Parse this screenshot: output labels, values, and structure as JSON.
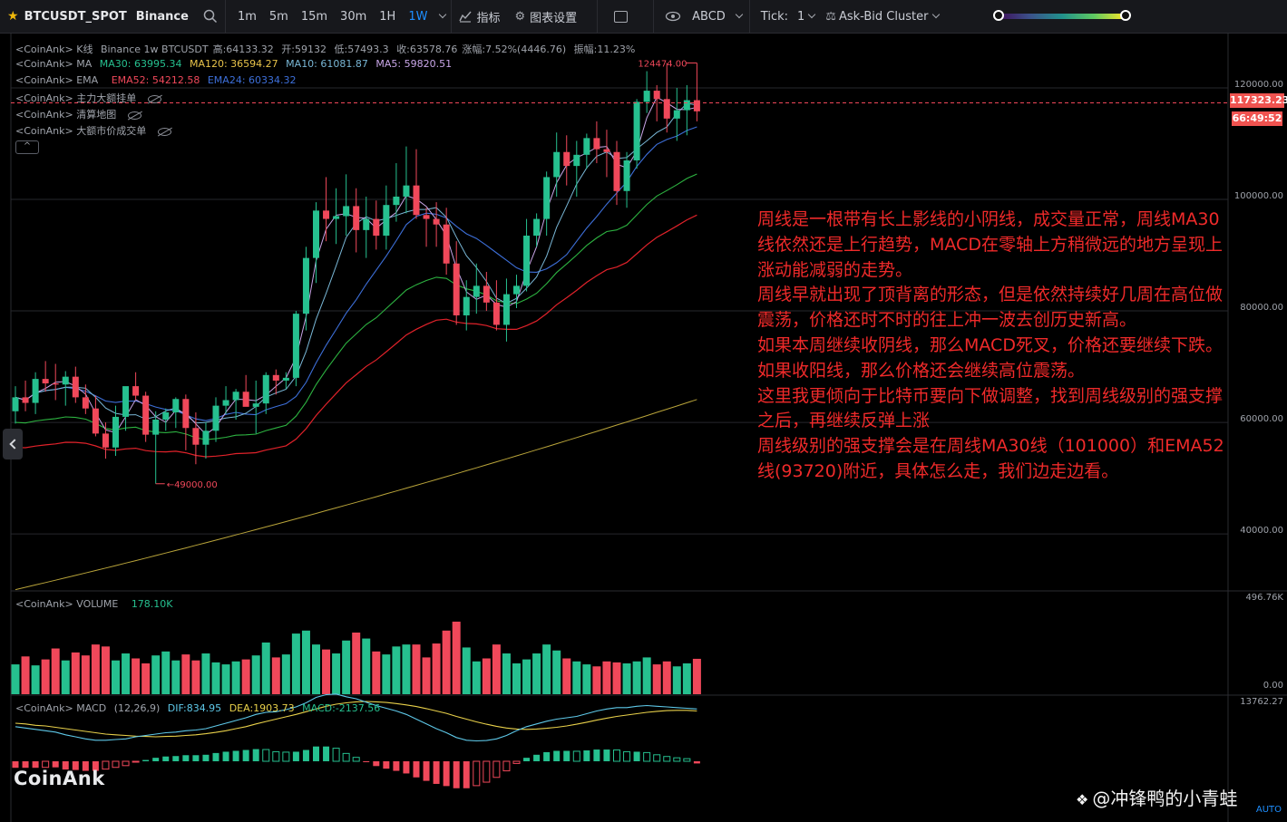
{
  "toolbar": {
    "symbol": "BTCUSDT_SPOT",
    "exchange": "Binance",
    "intervals": [
      "1m",
      "5m",
      "15m",
      "30m",
      "1H",
      "1W"
    ],
    "active_interval": "1W",
    "indicators_label": "指标",
    "chart_settings_label": "图表设置",
    "abcd_label": "ABCD",
    "tick_label": "Tick:",
    "tick_value": "1",
    "cluster_label": "Ask-Bid Cluster"
  },
  "legend": {
    "kline": {
      "prefix": "<CoinAnk> K线",
      "source": "Binance 1w BTCUSDT",
      "high": "高:64133.32",
      "open": "开:59132",
      "low": "低:57493.3",
      "close": "收:63578.76",
      "change": "涨幅:7.52%(4446.76)",
      "amplitude": "振幅:11.23%"
    },
    "ma": {
      "prefix": "<CoinAnk> MA",
      "ma30": "MA30: 63995.34",
      "ma120": "MA120: 36594.27",
      "ma10": "MA10: 61081.87",
      "ma5": "MA5: 59820.51"
    },
    "ema": {
      "prefix": "<CoinAnk> EMA",
      "ema52": "EMA52: 54212.58",
      "ema24": "EMA24: 60334.32"
    },
    "extra1": "<CoinAnk> 主力大额挂单",
    "extra2": "<CoinAnk> 清算地图",
    "extra3": "<CoinAnk> 大额市价成交单",
    "collapse": "^"
  },
  "price_axis": {
    "labels": [
      "120000.00",
      "100000.00",
      "80000.00",
      "60000.00",
      "40000.00"
    ],
    "current_price": "117323.23",
    "countdown": "66:49:52",
    "high_marker": "124474.00",
    "low_marker": "49000.00"
  },
  "volume_panel": {
    "title": "<CoinAnk> VOLUME",
    "value": "178.10K",
    "axis_top": "496.76K",
    "axis_bottom": "0.00"
  },
  "macd_panel": {
    "title": "<CoinAnk> MACD",
    "params": "(12,26,9)",
    "dif": "DIF:834.95",
    "dea": "DEA:1903.73",
    "macd": "MACD:-2137.56",
    "axis_top": "13762.27"
  },
  "annotation": [
    "周线是一根带有长上影线的小阴线，成交量正常，周线MA30线依然还是上行趋势，MACD在零轴上方稍微远的地方呈现上涨动能减弱的走势。",
    "周线早就出现了顶背离的形态，但是依然持续好几周在高位做震荡，价格还时不时的往上冲一波去创历史新高。",
    "如果本周继续收阴线，那么MACD死叉，价格还要继续下跌。如果收阳线，那么价格还会继续高位震荡。",
    "这里我更倾向于比特币要向下做调整，找到周线级别的强支撑之后，再继续反弹上涨",
    "周线级别的强支撑会是在周线MA30线（101000）和EMA52线(93720)附近，具体怎么走，我们边走边看。"
  ],
  "watermark": "CoinAnk",
  "credit": "@冲锋鸭的小青蛙",
  "auto_label": "AUTO",
  "colors": {
    "up": "#26c08f",
    "down": "#f0485a",
    "ma5": "#c9a6e8",
    "ma10": "#79b7d6",
    "ma30": "#3d6fd9",
    "ema24": "#2db341",
    "ema52": "#e0222a",
    "ma120": "#b9a43a",
    "dif": "#5ec8e8",
    "dea": "#e8d04a",
    "annotation": "#ef2a2a"
  },
  "chart_data": {
    "type": "candlestick",
    "interval": "1w",
    "symbol": "BTCUSDT",
    "ylim": [
      30000,
      130000
    ],
    "candles": [
      [
        62000,
        66500,
        59800,
        64500
      ],
      [
        64500,
        67500,
        62000,
        63500
      ],
      [
        63500,
        69000,
        61500,
        67800
      ],
      [
        67800,
        71000,
        65500,
        67000
      ],
      [
        67000,
        70500,
        64000,
        66800
      ],
      [
        66800,
        69200,
        63000,
        68200
      ],
      [
        68200,
        70000,
        63500,
        64500
      ],
      [
        64500,
        66800,
        61500,
        62500
      ],
      [
        62500,
        64800,
        57500,
        58000
      ],
      [
        58000,
        60000,
        53500,
        55500
      ],
      [
        55500,
        63000,
        54000,
        61000
      ],
      [
        61000,
        66000,
        58500,
        66500
      ],
      [
        66500,
        69000,
        64000,
        64800
      ],
      [
        64800,
        65500,
        56500,
        57800
      ],
      [
        57800,
        62000,
        49000,
        60500
      ],
      [
        60500,
        62500,
        58500,
        61800
      ],
      [
        61800,
        64500,
        59000,
        64200
      ],
      [
        64200,
        65000,
        55000,
        59000
      ],
      [
        59000,
        61800,
        52500,
        56000
      ],
      [
        56000,
        60000,
        53500,
        58500
      ],
      [
        58500,
        64500,
        56500,
        63000
      ],
      [
        63000,
        66500,
        61500,
        64000
      ],
      [
        64000,
        66000,
        60500,
        65500
      ],
      [
        65500,
        68500,
        63000,
        62800
      ],
      [
        62800,
        67500,
        58000,
        63400
      ],
      [
        63400,
        69000,
        61500,
        68500
      ],
      [
        68500,
        69500,
        65000,
        67500
      ],
      [
        67500,
        69000,
        66000,
        68000
      ],
      [
        68000,
        80000,
        66500,
        79500
      ],
      [
        79500,
        91500,
        76500,
        89500
      ],
      [
        89500,
        99500,
        85000,
        98000
      ],
      [
        98000,
        104000,
        92500,
        96500
      ],
      [
        96500,
        102000,
        92000,
        97000
      ],
      [
        97000,
        104500,
        93500,
        98800
      ],
      [
        98800,
        102000,
        90500,
        94500
      ],
      [
        94500,
        100500,
        89500,
        96500
      ],
      [
        96500,
        99800,
        91000,
        93500
      ],
      [
        93500,
        102500,
        91000,
        99000
      ],
      [
        99000,
        106500,
        96000,
        100500
      ],
      [
        100500,
        109500,
        97500,
        102500
      ],
      [
        102500,
        109000,
        96500,
        97200
      ],
      [
        97200,
        98500,
        91500,
        96500
      ],
      [
        96500,
        99500,
        91500,
        95500
      ],
      [
        95500,
        98500,
        86500,
        88500
      ],
      [
        88500,
        92500,
        77500,
        79200
      ],
      [
        79200,
        85500,
        76500,
        82500
      ],
      [
        82500,
        88500,
        79500,
        84500
      ],
      [
        84500,
        87000,
        80000,
        81500
      ],
      [
        81500,
        85500,
        76500,
        77500
      ],
      [
        77500,
        85800,
        74500,
        83000
      ],
      [
        83000,
        86500,
        80500,
        84500
      ],
      [
        84500,
        96500,
        83500,
        93500
      ],
      [
        93500,
        97500,
        91500,
        96500
      ],
      [
        96500,
        105000,
        93500,
        104000
      ],
      [
        104000,
        112000,
        100500,
        108500
      ],
      [
        108500,
        111500,
        102500,
        106000
      ],
      [
        106000,
        110500,
        100500,
        108000
      ],
      [
        108000,
        111800,
        105500,
        111000
      ],
      [
        111000,
        114000,
        106500,
        109000
      ],
      [
        109000,
        112500,
        104000,
        108500
      ],
      [
        108500,
        110500,
        99000,
        101500
      ],
      [
        101500,
        108500,
        98500,
        107000
      ],
      [
        107000,
        118000,
        105500,
        117500
      ],
      [
        117500,
        123000,
        115500,
        119500
      ],
      [
        119500,
        120500,
        114000,
        118000
      ],
      [
        118000,
        124474,
        112000,
        114500
      ],
      [
        114500,
        120000,
        110500,
        116000
      ],
      [
        116000,
        120500,
        111500,
        117800
      ],
      [
        117800,
        124474,
        114000,
        115800
      ]
    ],
    "volume_scale_max": 496760,
    "volumes": [
      150,
      190,
      145,
      175,
      230,
      170,
      210,
      195,
      250,
      240,
      170,
      205,
      180,
      155,
      195,
      215,
      170,
      200,
      170,
      205,
      160,
      150,
      165,
      175,
      195,
      260,
      185,
      200,
      305,
      320,
      250,
      225,
      205,
      270,
      310,
      280,
      215,
      200,
      240,
      250,
      250,
      185,
      255,
      320,
      365,
      235,
      165,
      180,
      250,
      205,
      155,
      175,
      205,
      250,
      220,
      180,
      165,
      150,
      140,
      165,
      160,
      155,
      165,
      185,
      150,
      165,
      140,
      155,
      178
    ],
    "macd": {
      "dif": [
        2700,
        2500,
        2300,
        2100,
        1900,
        1500,
        1200,
        900,
        700,
        700,
        800,
        900,
        1200,
        1400,
        1600,
        1800,
        1900,
        2100,
        2200,
        2400,
        2800,
        3200,
        3600,
        4000,
        4500,
        4800,
        4900,
        5200,
        5600,
        6200,
        7000,
        7400,
        7500,
        7100,
        6800,
        6300,
        5800,
        5400,
        5000,
        4500,
        3800,
        3100,
        2400,
        1800,
        1100,
        700,
        600,
        650,
        900,
        1400,
        2100,
        2700,
        3100,
        3500,
        3800,
        4000,
        4200,
        4600,
        5000,
        5300,
        5500,
        5500,
        5700,
        5800,
        5700,
        5600,
        5500,
        5400,
        5300
      ],
      "dea": [
        3200,
        3100,
        2900,
        2800,
        2600,
        2400,
        2200,
        2000,
        1800,
        1600,
        1500,
        1400,
        1300,
        1250,
        1200,
        1250,
        1300,
        1400,
        1500,
        1650,
        1850,
        2100,
        2400,
        2700,
        3100,
        3450,
        3800,
        4150,
        4500,
        4900,
        5300,
        5700,
        6000,
        6200,
        6350,
        6400,
        6350,
        6250,
        6100,
        5900,
        5650,
        5350,
        5000,
        4650,
        4200,
        3800,
        3400,
        3050,
        2750,
        2500,
        2350,
        2300,
        2350,
        2450,
        2600,
        2800,
        3050,
        3350,
        3650,
        3950,
        4200,
        4400,
        4600,
        4800,
        4950,
        5050,
        5100,
        5100,
        5000
      ],
      "hist": [
        -1500,
        -1500,
        -1500,
        -1400,
        -1400,
        -1900,
        -2000,
        -2200,
        -2200,
        -1800,
        -1400,
        -1000,
        -200,
        300,
        800,
        1100,
        1200,
        1400,
        1400,
        1500,
        1900,
        2200,
        2400,
        2600,
        2800,
        2700,
        2200,
        2100,
        2200,
        2600,
        3400,
        3400,
        3000,
        1800,
        900,
        -200,
        -1100,
        -1700,
        -2200,
        -2800,
        -3700,
        -4500,
        -5200,
        -5700,
        -6200,
        -6200,
        -5600,
        -4800,
        -3700,
        -2200,
        -500,
        800,
        1500,
        2100,
        2400,
        2400,
        2300,
        2500,
        2700,
        2700,
        2600,
        2200,
        2200,
        2000,
        1500,
        1100,
        800,
        600,
        -500
      ]
    }
  }
}
